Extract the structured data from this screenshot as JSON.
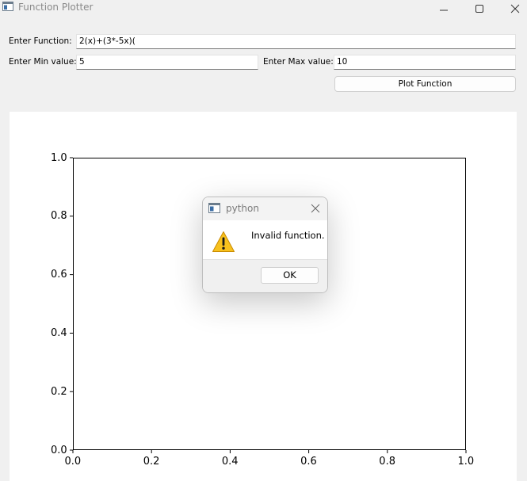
{
  "window": {
    "title": "Function Plotter",
    "controls": [
      "minimize",
      "maximize",
      "close"
    ]
  },
  "form": {
    "function_label": "Enter Function:",
    "function_value": "2(x)+(3*-5x)(",
    "min_label": "Enter Min value:",
    "min_value": "5",
    "max_label": "Enter Max value:",
    "max_value": "10",
    "plot_button": "Plot Function"
  },
  "chart_data": {
    "type": "line",
    "series": [],
    "xlim": [
      0.0,
      1.0
    ],
    "ylim": [
      0.0,
      1.0
    ],
    "x_ticks": [
      "0.0",
      "0.2",
      "0.4",
      "0.6",
      "0.8",
      "1.0"
    ],
    "y_ticks": [
      "0.0",
      "0.2",
      "0.4",
      "0.6",
      "0.8",
      "1.0"
    ],
    "title": "",
    "xlabel": "",
    "ylabel": "",
    "grid": false
  },
  "dialog": {
    "title": "python",
    "message": "Invalid function.",
    "ok_button": "OK",
    "icon": "warning-icon"
  },
  "colors": {
    "warning_yellow": "#f7c11e",
    "background": "#f0f0f0"
  }
}
